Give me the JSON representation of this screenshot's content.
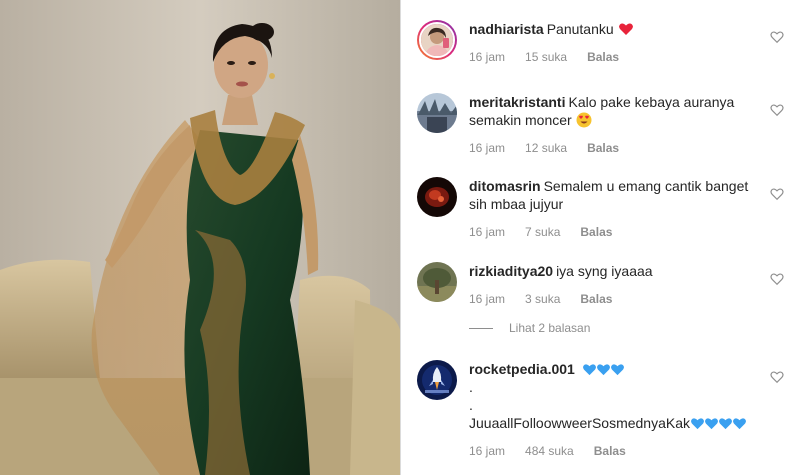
{
  "colors": {
    "username": "#262626",
    "meta": "#8e8e8e",
    "heart_red": "#ed4956",
    "heart_blue": "#3897f0",
    "divider": "#dbdbdb"
  },
  "comments": [
    {
      "username": "nadhiarista",
      "text": "Panutanku",
      "emoji": "red-heart",
      "time": "16 jam",
      "likes": "15 suka",
      "reply": "Balas",
      "avatar": "avatar-with-story-ring"
    },
    {
      "username": "meritakristanti",
      "text": "Kalo pake kebaya auranya semakin moncer",
      "emoji": "heart-eyes-face",
      "time": "16 jam",
      "likes": "12 suka",
      "reply": "Balas"
    },
    {
      "username": "ditomasrin",
      "text": "Semalem u emang cantik banget sih mbaa jujyur",
      "time": "16 jam",
      "likes": "7 suka",
      "reply": "Balas"
    },
    {
      "username": "rizkiaditya20",
      "text": "iya syng iyaaaa",
      "time": "16 jam",
      "likes": "3 suka",
      "reply": "Balas"
    },
    {
      "username": "rocketpedia.001",
      "text_line1": ".",
      "text_line2": ".",
      "text_line3": "JuuaallFolloowweerSosmednyaKak",
      "emoji": "blue-hearts",
      "time": "16 jam",
      "likes": "484 suka",
      "reply": "Balas"
    }
  ],
  "view_replies": "Lihat 2 balasan",
  "icons": {
    "like": "heart-outline-icon"
  }
}
